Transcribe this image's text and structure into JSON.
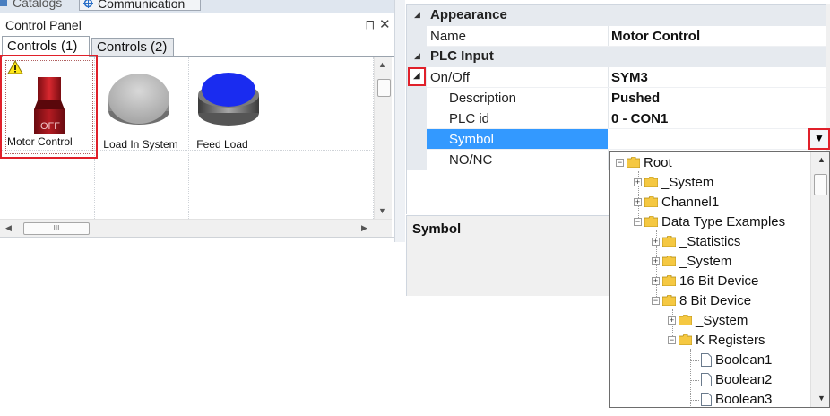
{
  "top_tabs": [
    {
      "label": "Catalogs"
    },
    {
      "label": "Communication"
    }
  ],
  "control_panel": {
    "title": "Control Panel",
    "tabs": [
      {
        "label": "Controls (1)",
        "active": true
      },
      {
        "label": "Controls (2)",
        "active": false
      }
    ],
    "controls": [
      {
        "label": "Motor Control",
        "switch_text": "OFF",
        "warning": true,
        "selected": true
      },
      {
        "label": "Load In System"
      },
      {
        "label": "Feed Load"
      }
    ],
    "scroll_grip": "III"
  },
  "property_grid": {
    "categories": [
      {
        "label": "Appearance",
        "rows": [
          {
            "name": "Name",
            "value": "Motor Control"
          }
        ]
      },
      {
        "label": "PLC Input",
        "rows": [
          {
            "name": "On/Off",
            "value": "SYM3"
          },
          {
            "name": "Description",
            "value": "Pushed"
          },
          {
            "name": "PLC id",
            "value": "0 - CON1"
          },
          {
            "name": "Symbol",
            "value": "",
            "selected": true
          },
          {
            "name": "NO/NC",
            "value": ""
          }
        ]
      }
    ],
    "description_title": "Symbol"
  },
  "symbol_tree": {
    "nodes": [
      {
        "label": "Root",
        "type": "folder",
        "expander": "−"
      },
      {
        "label": "_System",
        "type": "folder",
        "expander": "+"
      },
      {
        "label": "Channel1",
        "type": "folder",
        "expander": "+"
      },
      {
        "label": "Data Type Examples",
        "type": "folder",
        "expander": "−"
      },
      {
        "label": "_Statistics",
        "type": "folder",
        "expander": "+"
      },
      {
        "label": "_System",
        "type": "folder",
        "expander": "+"
      },
      {
        "label": "16 Bit Device",
        "type": "folder",
        "expander": "+"
      },
      {
        "label": "8 Bit Device",
        "type": "folder",
        "expander": "−"
      },
      {
        "label": "_System",
        "type": "folder",
        "expander": "+"
      },
      {
        "label": "K Registers",
        "type": "folder",
        "expander": "−"
      },
      {
        "label": "Boolean1",
        "type": "item"
      },
      {
        "label": "Boolean2",
        "type": "item"
      },
      {
        "label": "Boolean3",
        "type": "item"
      }
    ]
  },
  "colors": {
    "selection_blue": "#3399ff",
    "highlight_red": "#e0202a",
    "folder_yellow": "#f5c842",
    "feed_load_blue": "#1a2cf0"
  }
}
